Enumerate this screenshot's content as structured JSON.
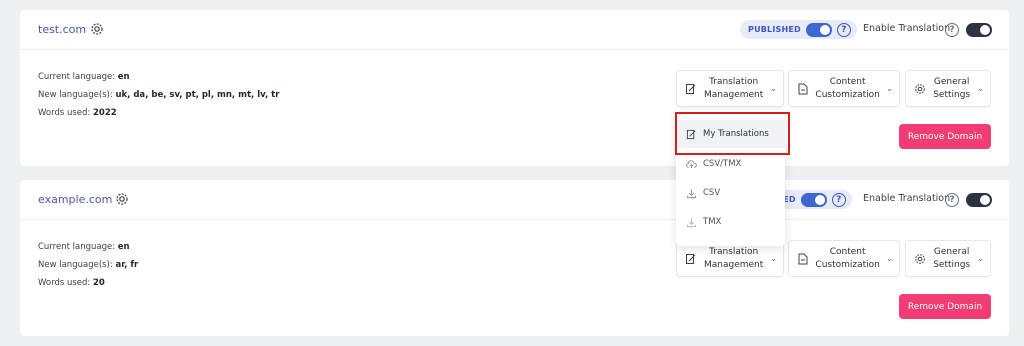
{
  "domains": [
    {
      "name": "test.com",
      "published_label": "PUBLISHED",
      "enable_translation_label": "Enable Translation",
      "current_language_label": "Current language:",
      "current_language": "en",
      "new_languages_label": "New language(s):",
      "new_languages": "uk, da, be, sv, pt, pl, mn, mt, lv, tr",
      "words_used_label": "Words used:",
      "words_used": "2022",
      "translation_management": [
        "Translation",
        "Management"
      ],
      "content_customization": [
        "Content",
        "Customization"
      ],
      "general_settings": [
        "General",
        "Settings"
      ],
      "remove_label": "Remove Domain"
    },
    {
      "name": "example.com",
      "published_label": "IED",
      "enable_translation_label": "Enable Translation",
      "current_language_label": "Current language:",
      "current_language": "en",
      "new_languages_label": "New language(s):",
      "new_languages": "ar, fr",
      "words_used_label": "Words used:",
      "words_used": "20",
      "translation_management": [
        "Translation",
        "Management"
      ],
      "content_customization": [
        "Content",
        "Customization"
      ],
      "general_settings": [
        "General",
        "Settings"
      ],
      "remove_label": "Remove Domain"
    }
  ],
  "dropdown": {
    "items": [
      {
        "label": "My Translations",
        "icon": "edit-document-icon"
      },
      {
        "label": "CSV/TMX",
        "icon": "cloud-upload-icon"
      },
      {
        "label": "CSV",
        "icon": "download-icon"
      },
      {
        "label": "TMX",
        "icon": "download-icon"
      }
    ]
  },
  "colors": {
    "accent": "#3e68d0",
    "remove": "#f23d74",
    "highlight": "#d41f1f"
  }
}
